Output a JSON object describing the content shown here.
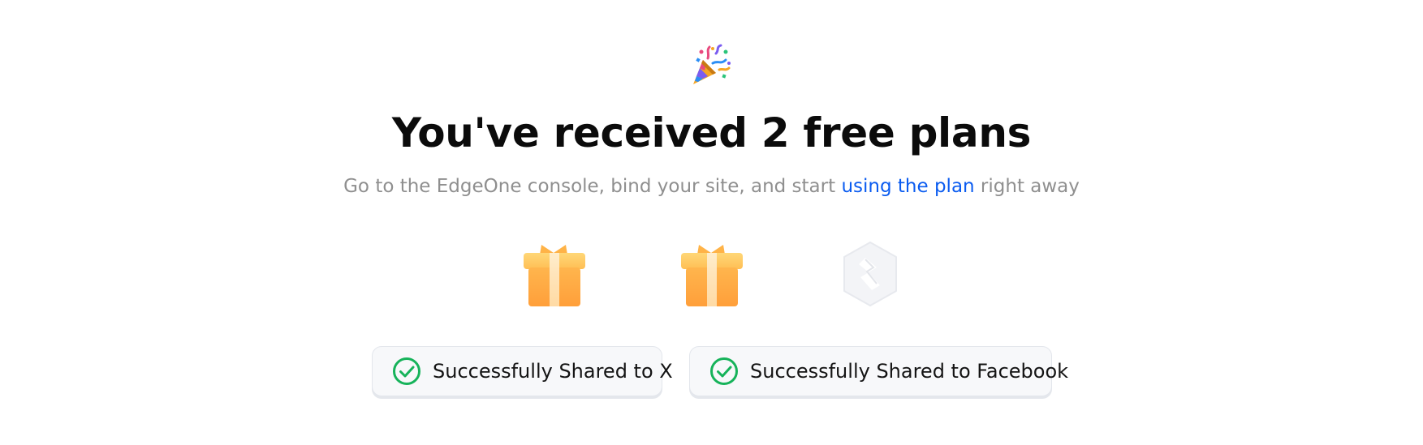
{
  "header": {
    "title": "You've received 2 free plans",
    "subtitle_before": "Go to the EdgeOne console, bind your site, and start ",
    "subtitle_link": "using the plan",
    "subtitle_after": " right away"
  },
  "rewards": [
    {
      "icon": "gift-icon",
      "state": "unlocked"
    },
    {
      "icon": "gift-icon",
      "state": "unlocked"
    },
    {
      "icon": "edgeone-hex-icon",
      "state": "locked"
    }
  ],
  "share_status": [
    {
      "label": "Successfully Shared to X",
      "icon": "check-circle-icon"
    },
    {
      "label": "Successfully Shared to Facebook",
      "icon": "check-circle-icon"
    }
  ],
  "colors": {
    "link": "#0b5cf0",
    "success": "#16b35a",
    "gift_orange": "#ffae45"
  }
}
